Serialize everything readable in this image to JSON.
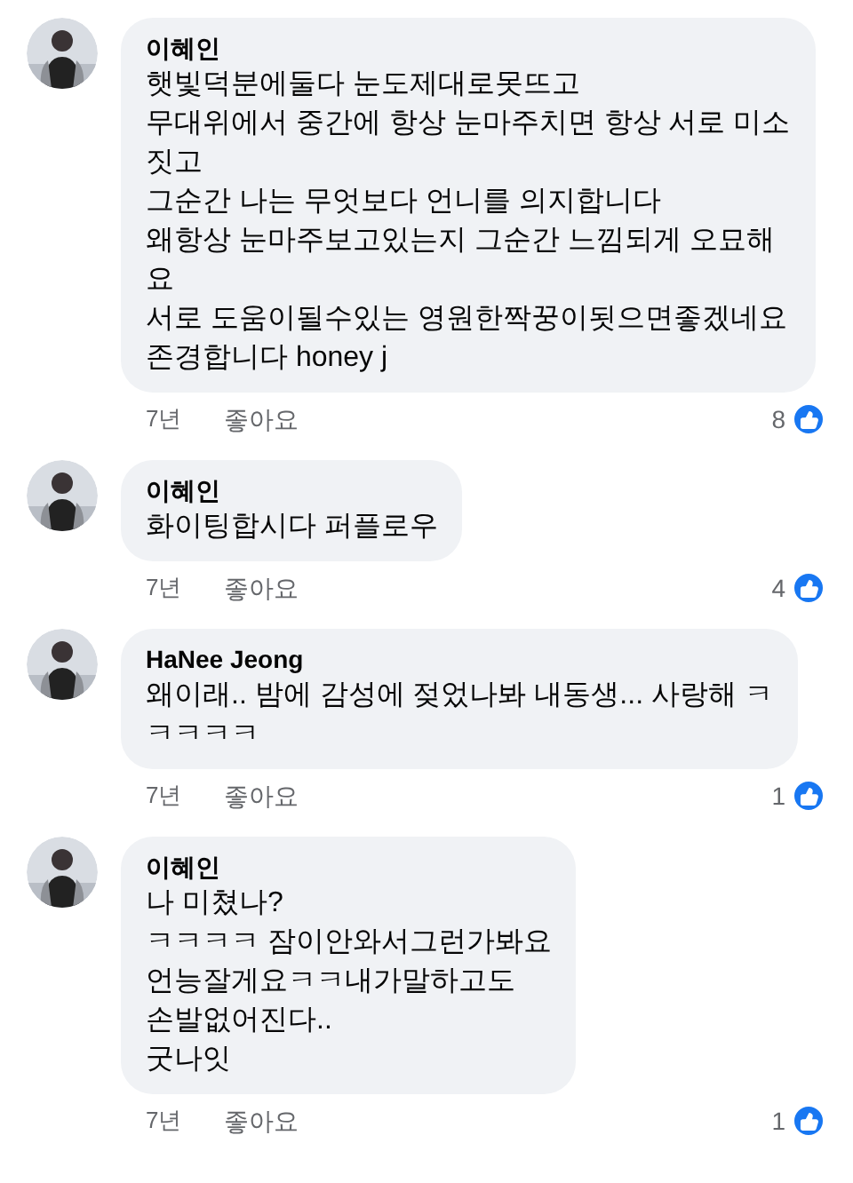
{
  "comments": [
    {
      "avatar": {
        "kind": "picture"
      },
      "author": "이혜인",
      "lines": [
        "햇빛덕분에둘다 눈도제대로못뜨고",
        "무대위에서 중간에 항상 눈마주치면 항상 서로 미소",
        "짓고",
        "그순간 나는 무엇보다 언니를 의지합니다",
        "왜항상 눈마주보고있는지 그순간 느낌되게 오묘해",
        "요",
        "서로 도움이될수있는 영원한짝꿍이됫으면좋겠네요",
        "존경합니다 honey j"
      ],
      "time": "7년",
      "like_action": "좋아요",
      "reactions": "8"
    },
    {
      "avatar": {
        "kind": "picture"
      },
      "author": "이혜인",
      "lines": [
        "화이팅합시다 퍼플로우"
      ],
      "time": "7년",
      "like_action": "좋아요",
      "reactions": "4"
    },
    {
      "avatar": {
        "kind": "picture"
      },
      "author": "HaNee Jeong",
      "lines": [
        "왜이래.. 밤에 감성에 젖었나봐 내동생... 사랑해 ㅋ",
        "ㅋㅋㅋㅋ"
      ],
      "time": "7년",
      "like_action": "좋아요",
      "reactions": "1"
    },
    {
      "avatar": {
        "kind": "picture"
      },
      "author": "이혜인",
      "lines": [
        "나 미쳤나?",
        "ㅋㅋㅋㅋ 잠이안와서그런가봐요",
        "언능잘게요ㅋㅋ내가말하고도",
        "손발없어진다..",
        "굿나잇"
      ],
      "time": "7년",
      "like_action": "좋아요",
      "reactions": "1"
    }
  ]
}
